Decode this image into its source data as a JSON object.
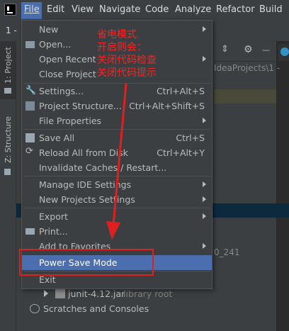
{
  "menubar": {
    "items": [
      {
        "label": "File",
        "mnemonic_index": 0
      },
      {
        "label": "Edit",
        "mnemonic_index": 0
      },
      {
        "label": "View",
        "mnemonic_index": 0
      },
      {
        "label": "Navigate",
        "mnemonic_index": 0
      },
      {
        "label": "Code",
        "mnemonic_index": 0
      },
      {
        "label": "Analyze",
        "mnemonic_index": 0
      },
      {
        "label": "Refactor",
        "mnemonic_index": 0
      },
      {
        "label": "Build",
        "mnemonic_index": 0
      }
    ]
  },
  "toolbar": {
    "index_label": "1 -"
  },
  "left_strip": {
    "project_tab": "1: Project",
    "structure_tab": "Z: Structure"
  },
  "panel": {
    "path_fragment": "IdeaProjects\\1 -",
    "jdk_fragment": "0_241",
    "right_edge_number": "1",
    "tree": {
      "junit_label": "junit-4.12.jar",
      "junit_hint": "library root",
      "scratches_label": "Scratches and Consoles"
    }
  },
  "file_menu": {
    "items": [
      {
        "label": "New",
        "shortcut": "",
        "submenu": true
      },
      {
        "label": "Open...",
        "shortcut": "",
        "submenu": false
      },
      {
        "label": "Open Recent",
        "shortcut": "",
        "submenu": true
      },
      {
        "label": "Close Project",
        "shortcut": "",
        "submenu": false
      },
      {
        "label": "Settings...",
        "shortcut": "Ctrl+Alt+S",
        "submenu": false
      },
      {
        "label": "Project Structure...",
        "shortcut": "Ctrl+Alt+Shift+S",
        "submenu": false
      },
      {
        "label": "File Properties",
        "shortcut": "",
        "submenu": true
      },
      {
        "label": "Save All",
        "shortcut": "Ctrl+S",
        "submenu": false
      },
      {
        "label": "Reload All from Disk",
        "shortcut": "Ctrl+Alt+Y",
        "submenu": false
      },
      {
        "label": "Invalidate Caches / Restart...",
        "shortcut": "",
        "submenu": false
      },
      {
        "label": "Manage IDE Settings",
        "shortcut": "",
        "submenu": true
      },
      {
        "label": "New Projects Settings",
        "shortcut": "",
        "submenu": true
      },
      {
        "label": "Export",
        "shortcut": "",
        "submenu": true
      },
      {
        "label": "Print...",
        "shortcut": "",
        "submenu": false
      },
      {
        "label": "Add to Favorites",
        "shortcut": "",
        "submenu": true
      },
      {
        "label": "Power Save Mode",
        "shortcut": "",
        "submenu": false
      },
      {
        "label": "Exit",
        "shortcut": "",
        "submenu": false
      }
    ]
  },
  "annotation": {
    "lines": [
      "省电模式",
      "开启则会：",
      "关闭代码检查",
      "关闭代码提示"
    ],
    "color": "#ff2020"
  },
  "colors": {
    "menubar_bg": "#3c3f41",
    "selection": "#4b6eaf",
    "text": "#bbbbbb"
  }
}
